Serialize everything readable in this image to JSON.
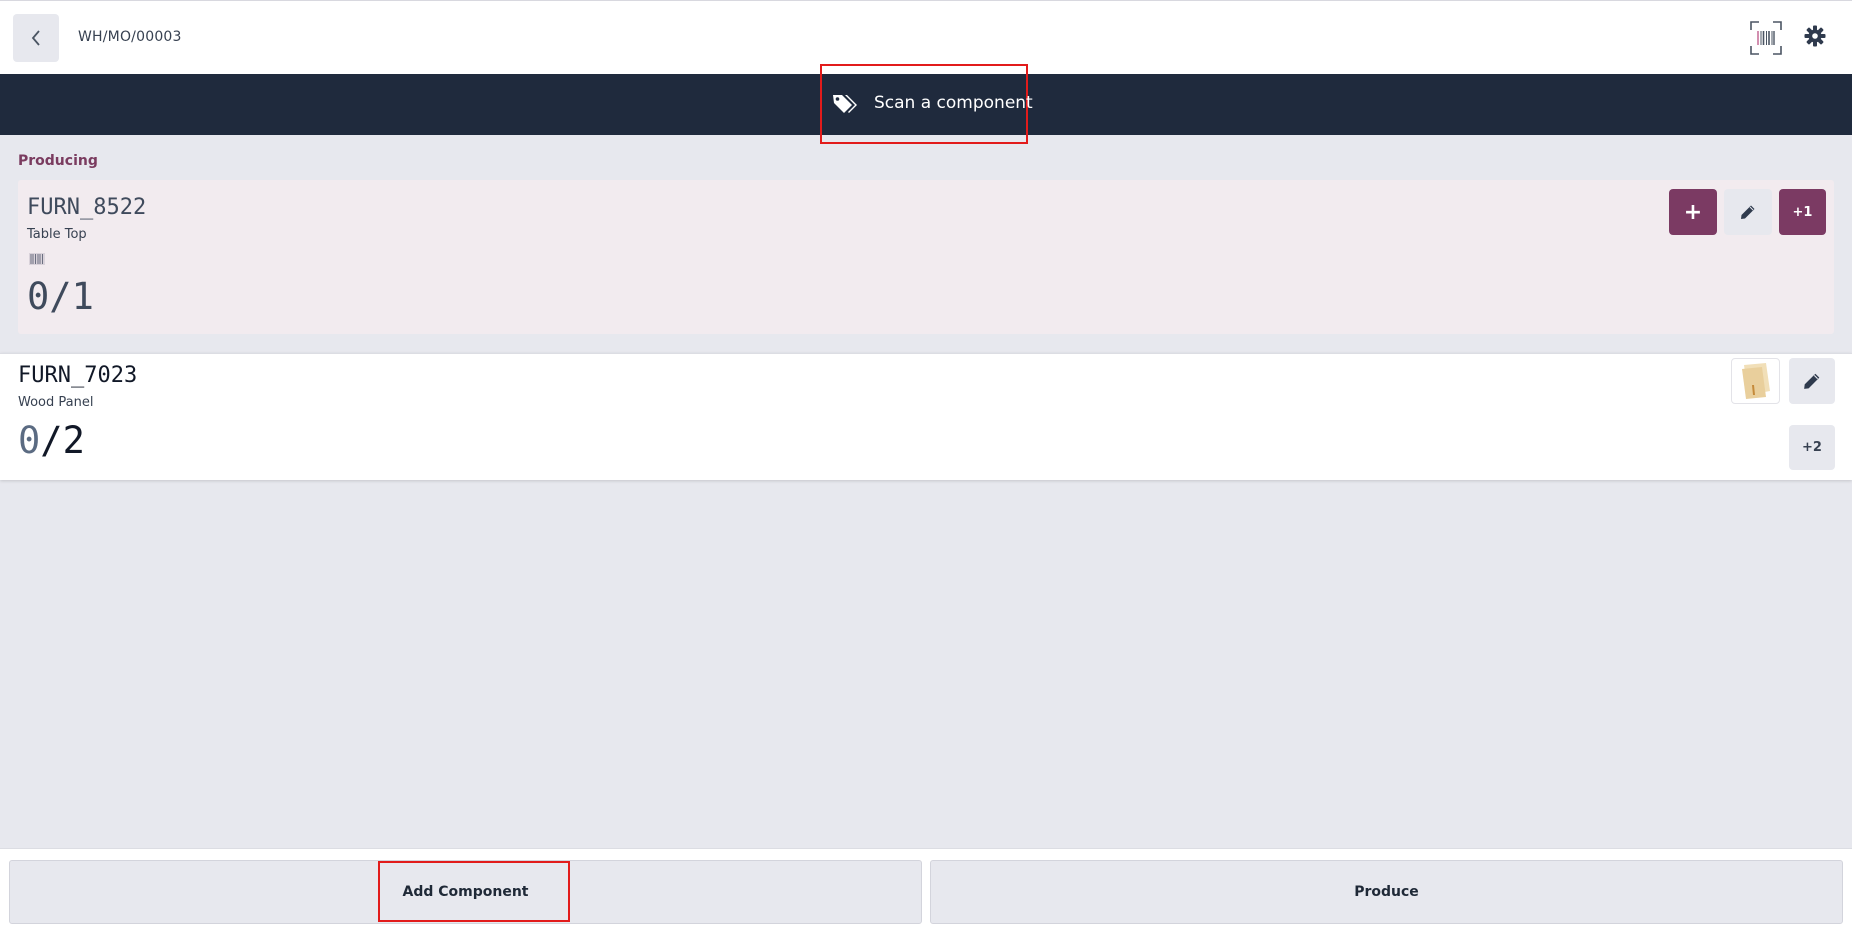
{
  "header": {
    "reference": "WH/MO/00003",
    "back_icon": "chevron-left-icon",
    "scan_icon": "barcode-scan-icon",
    "settings_icon": "gear-icon"
  },
  "banner": {
    "message": "Scan a component",
    "icon": "tags-icon"
  },
  "producing": {
    "section_label": "Producing",
    "product_code": "FURN_8522",
    "product_name": "Table Top",
    "qty_done": "0",
    "qty_separator": "/",
    "qty_total": "1",
    "buttons": {
      "add_label": "+",
      "increment_label": "+1"
    }
  },
  "components": [
    {
      "product_code": "FURN_7023",
      "product_name": "Wood Panel",
      "qty_done": "0",
      "qty_separator": "/",
      "qty_total": "2",
      "increment_label": "+2"
    }
  ],
  "footer": {
    "add_component_label": "Add Component",
    "produce_label": "Produce"
  },
  "colors": {
    "accent": "#7b3a63",
    "banner_bg": "#1f2a3d",
    "producing_bg": "#f2ebef",
    "page_bg": "#e7e8ee"
  }
}
